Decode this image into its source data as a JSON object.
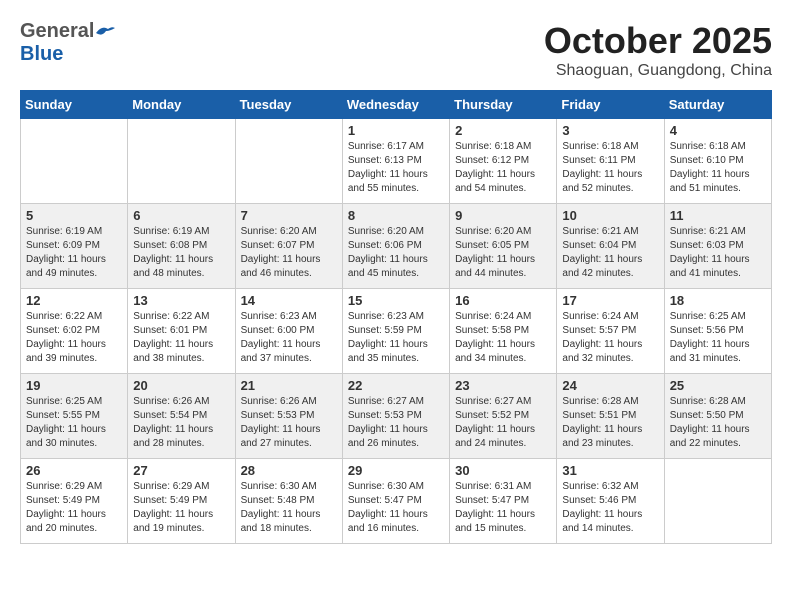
{
  "header": {
    "logo_general": "General",
    "logo_blue": "Blue",
    "month": "October 2025",
    "location": "Shaoguan, Guangdong, China"
  },
  "weekdays": [
    "Sunday",
    "Monday",
    "Tuesday",
    "Wednesday",
    "Thursday",
    "Friday",
    "Saturday"
  ],
  "weeks": [
    [
      {
        "day": "",
        "info": ""
      },
      {
        "day": "",
        "info": ""
      },
      {
        "day": "",
        "info": ""
      },
      {
        "day": "1",
        "info": "Sunrise: 6:17 AM\nSunset: 6:13 PM\nDaylight: 11 hours\nand 55 minutes."
      },
      {
        "day": "2",
        "info": "Sunrise: 6:18 AM\nSunset: 6:12 PM\nDaylight: 11 hours\nand 54 minutes."
      },
      {
        "day": "3",
        "info": "Sunrise: 6:18 AM\nSunset: 6:11 PM\nDaylight: 11 hours\nand 52 minutes."
      },
      {
        "day": "4",
        "info": "Sunrise: 6:18 AM\nSunset: 6:10 PM\nDaylight: 11 hours\nand 51 minutes."
      }
    ],
    [
      {
        "day": "5",
        "info": "Sunrise: 6:19 AM\nSunset: 6:09 PM\nDaylight: 11 hours\nand 49 minutes."
      },
      {
        "day": "6",
        "info": "Sunrise: 6:19 AM\nSunset: 6:08 PM\nDaylight: 11 hours\nand 48 minutes."
      },
      {
        "day": "7",
        "info": "Sunrise: 6:20 AM\nSunset: 6:07 PM\nDaylight: 11 hours\nand 46 minutes."
      },
      {
        "day": "8",
        "info": "Sunrise: 6:20 AM\nSunset: 6:06 PM\nDaylight: 11 hours\nand 45 minutes."
      },
      {
        "day": "9",
        "info": "Sunrise: 6:20 AM\nSunset: 6:05 PM\nDaylight: 11 hours\nand 44 minutes."
      },
      {
        "day": "10",
        "info": "Sunrise: 6:21 AM\nSunset: 6:04 PM\nDaylight: 11 hours\nand 42 minutes."
      },
      {
        "day": "11",
        "info": "Sunrise: 6:21 AM\nSunset: 6:03 PM\nDaylight: 11 hours\nand 41 minutes."
      }
    ],
    [
      {
        "day": "12",
        "info": "Sunrise: 6:22 AM\nSunset: 6:02 PM\nDaylight: 11 hours\nand 39 minutes."
      },
      {
        "day": "13",
        "info": "Sunrise: 6:22 AM\nSunset: 6:01 PM\nDaylight: 11 hours\nand 38 minutes."
      },
      {
        "day": "14",
        "info": "Sunrise: 6:23 AM\nSunset: 6:00 PM\nDaylight: 11 hours\nand 37 minutes."
      },
      {
        "day": "15",
        "info": "Sunrise: 6:23 AM\nSunset: 5:59 PM\nDaylight: 11 hours\nand 35 minutes."
      },
      {
        "day": "16",
        "info": "Sunrise: 6:24 AM\nSunset: 5:58 PM\nDaylight: 11 hours\nand 34 minutes."
      },
      {
        "day": "17",
        "info": "Sunrise: 6:24 AM\nSunset: 5:57 PM\nDaylight: 11 hours\nand 32 minutes."
      },
      {
        "day": "18",
        "info": "Sunrise: 6:25 AM\nSunset: 5:56 PM\nDaylight: 11 hours\nand 31 minutes."
      }
    ],
    [
      {
        "day": "19",
        "info": "Sunrise: 6:25 AM\nSunset: 5:55 PM\nDaylight: 11 hours\nand 30 minutes."
      },
      {
        "day": "20",
        "info": "Sunrise: 6:26 AM\nSunset: 5:54 PM\nDaylight: 11 hours\nand 28 minutes."
      },
      {
        "day": "21",
        "info": "Sunrise: 6:26 AM\nSunset: 5:53 PM\nDaylight: 11 hours\nand 27 minutes."
      },
      {
        "day": "22",
        "info": "Sunrise: 6:27 AM\nSunset: 5:53 PM\nDaylight: 11 hours\nand 26 minutes."
      },
      {
        "day": "23",
        "info": "Sunrise: 6:27 AM\nSunset: 5:52 PM\nDaylight: 11 hours\nand 24 minutes."
      },
      {
        "day": "24",
        "info": "Sunrise: 6:28 AM\nSunset: 5:51 PM\nDaylight: 11 hours\nand 23 minutes."
      },
      {
        "day": "25",
        "info": "Sunrise: 6:28 AM\nSunset: 5:50 PM\nDaylight: 11 hours\nand 22 minutes."
      }
    ],
    [
      {
        "day": "26",
        "info": "Sunrise: 6:29 AM\nSunset: 5:49 PM\nDaylight: 11 hours\nand 20 minutes."
      },
      {
        "day": "27",
        "info": "Sunrise: 6:29 AM\nSunset: 5:49 PM\nDaylight: 11 hours\nand 19 minutes."
      },
      {
        "day": "28",
        "info": "Sunrise: 6:30 AM\nSunset: 5:48 PM\nDaylight: 11 hours\nand 18 minutes."
      },
      {
        "day": "29",
        "info": "Sunrise: 6:30 AM\nSunset: 5:47 PM\nDaylight: 11 hours\nand 16 minutes."
      },
      {
        "day": "30",
        "info": "Sunrise: 6:31 AM\nSunset: 5:47 PM\nDaylight: 11 hours\nand 15 minutes."
      },
      {
        "day": "31",
        "info": "Sunrise: 6:32 AM\nSunset: 5:46 PM\nDaylight: 11 hours\nand 14 minutes."
      },
      {
        "day": "",
        "info": ""
      }
    ]
  ]
}
